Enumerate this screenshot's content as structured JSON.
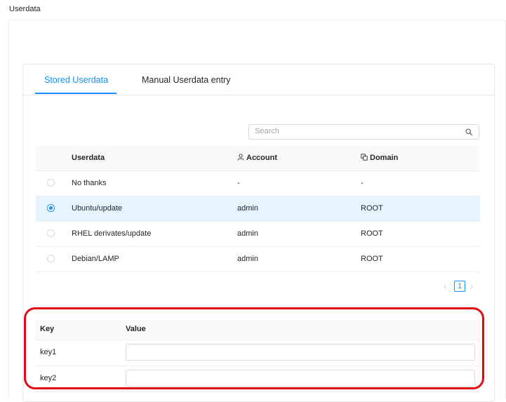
{
  "section_title": "Userdata",
  "tabs": [
    {
      "label": "Stored Userdata",
      "active": true
    },
    {
      "label": "Manual Userdata entry",
      "active": false
    }
  ],
  "search": {
    "placeholder": "Search",
    "icon": "search-icon"
  },
  "table": {
    "columns": {
      "userdata": "Userdata",
      "account": "Account",
      "domain": "Domain"
    },
    "column_icons": {
      "account": "user-icon",
      "domain": "domain-icon"
    },
    "rows": [
      {
        "name": "No thanks",
        "account": "-",
        "domain": "-",
        "selected": false
      },
      {
        "name": "Ubuntu/update",
        "account": "admin",
        "domain": "ROOT",
        "selected": true
      },
      {
        "name": "RHEL derivates/update",
        "account": "admin",
        "domain": "ROOT",
        "selected": false
      },
      {
        "name": "Debian/LAMP",
        "account": "admin",
        "domain": "ROOT",
        "selected": false
      }
    ]
  },
  "pagination": {
    "current_page": "1",
    "prev": "‹",
    "next": "›"
  },
  "kv": {
    "headers": {
      "key": "Key",
      "value": "Value"
    },
    "rows": [
      {
        "key": "key1",
        "value": ""
      },
      {
        "key": "key2",
        "value": ""
      }
    ]
  },
  "colors": {
    "accent": "#1890ff",
    "selected_row": "#e6f4ff",
    "highlight": "#e30613"
  }
}
